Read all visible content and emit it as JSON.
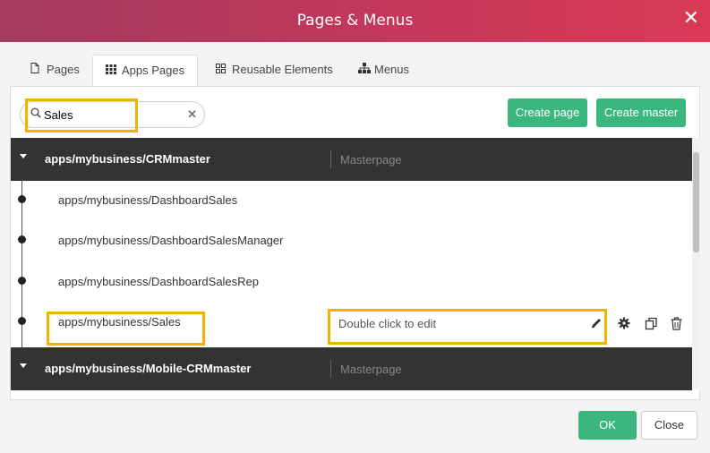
{
  "dialog": {
    "title": "Pages & Menus",
    "close_icon": "close-icon"
  },
  "tabs": [
    {
      "label": "Pages",
      "icon": "page-icon",
      "active": false
    },
    {
      "label": "Apps Pages",
      "icon": "grid-icon",
      "active": true
    },
    {
      "label": "Reusable Elements",
      "icon": "elements-icon",
      "active": false
    },
    {
      "label": "Menus",
      "icon": "sitemap-icon",
      "active": false
    }
  ],
  "search": {
    "value": "Sales",
    "icon": "search-icon",
    "clear_icon": "clear-icon"
  },
  "toolbar": {
    "create_page": "Create page",
    "create_master": "Create master"
  },
  "masters": [
    {
      "name": "apps/mybusiness/CRMmaster",
      "type": "Masterpage"
    },
    {
      "name": "apps/mybusiness/Mobile-CRMmaster",
      "type": "Masterpage"
    }
  ],
  "pages": [
    {
      "name": "apps/mybusiness/DashboardSales"
    },
    {
      "name": "apps/mybusiness/DashboardSalesManager"
    },
    {
      "name": "apps/mybusiness/DashboardSalesRep"
    },
    {
      "name": "apps/mybusiness/Sales",
      "description": "Double click to edit"
    }
  ],
  "row_actions": [
    "pencil-icon",
    "gear-icon",
    "duplicate-icon",
    "trash-icon"
  ],
  "footer": {
    "ok": "OK",
    "close": "Close"
  },
  "colors": {
    "title_gradient_start": "#a33a60",
    "title_gradient_end": "#d93a55",
    "green": "#3bb77e",
    "dark_row": "#333333",
    "highlight": "#f0b400"
  }
}
